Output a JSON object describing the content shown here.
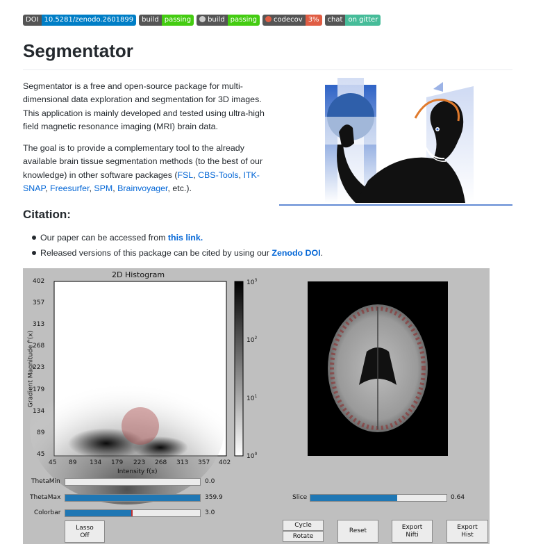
{
  "badges": [
    {
      "left": "DOI",
      "right": "10.5281/zenodo.2601899",
      "color": "#007ec6",
      "icon": ""
    },
    {
      "left": "build",
      "right": "passing",
      "color": "#44cc11",
      "icon": ""
    },
    {
      "left": "build",
      "right": "passing",
      "color": "#44cc11",
      "icon": "circleci-icon"
    },
    {
      "left": "codecov",
      "right": "3%",
      "color": "#e05d44",
      "icon": "codecov-icon"
    },
    {
      "left": "chat",
      "right": "on gitter",
      "color": "#46bc99",
      "icon": ""
    }
  ],
  "title": "Segmentator",
  "intro": "Segmentator is a free and open-source package for multi-dimensional data exploration and segmentation for 3D images. This application is mainly developed and tested using ultra-high field magnetic resonance imaging (MRI) brain data.",
  "goal": {
    "prefix": "The goal is to provide a complementary tool to the already available brain tissue segmentation methods (to the best of our knowledge) in other software packages (",
    "links": [
      "FSL",
      "CBS-Tools",
      "ITK-SNAP",
      "Freesurfer",
      "SPM",
      "Brainvoyager"
    ],
    "sep": ", ",
    "suffix": ", etc.)."
  },
  "citation": {
    "heading": "Citation:",
    "item1_text": "Our paper can be accessed from ",
    "item1_link": "this link.",
    "item2_text": "Released versions of this package can be cited by using our ",
    "item2_link": "Zenodo DOI",
    "item2_end": "."
  },
  "gui": {
    "histogram_title": "2D Histogram",
    "xlabel": "Intensity f(x)",
    "ylabel": "Gradient Magnitude f'(x)",
    "xticks": [
      "45",
      "89",
      "134",
      "179",
      "223",
      "268",
      "313",
      "357",
      "402"
    ],
    "yticks": [
      "402",
      "357",
      "313",
      "268",
      "223",
      "179",
      "134",
      "89",
      "45"
    ],
    "colorbar_ticks": [
      {
        "base": "10",
        "exp": "3"
      },
      {
        "base": "10",
        "exp": "2"
      },
      {
        "base": "10",
        "exp": "1"
      },
      {
        "base": "10",
        "exp": "0"
      }
    ],
    "sliders": [
      {
        "label": "ThetaMin",
        "value": "0.0",
        "fraction": 0.0
      },
      {
        "label": "ThetaMax",
        "value": "359.9",
        "fraction": 1.0
      },
      {
        "label": "Colorbar",
        "value": "3.0",
        "fraction": 0.5
      }
    ],
    "slice": {
      "label": "Slice",
      "value": "0.64",
      "fraction": 0.64
    },
    "buttons": {
      "lasso": [
        "Lasso",
        "Off"
      ],
      "cycle": "Cycle",
      "rotate": "Rotate",
      "reset": "Reset",
      "export_nifti": [
        "Export",
        "Nifti"
      ],
      "export_hist": [
        "Export",
        "Hist"
      ]
    }
  }
}
